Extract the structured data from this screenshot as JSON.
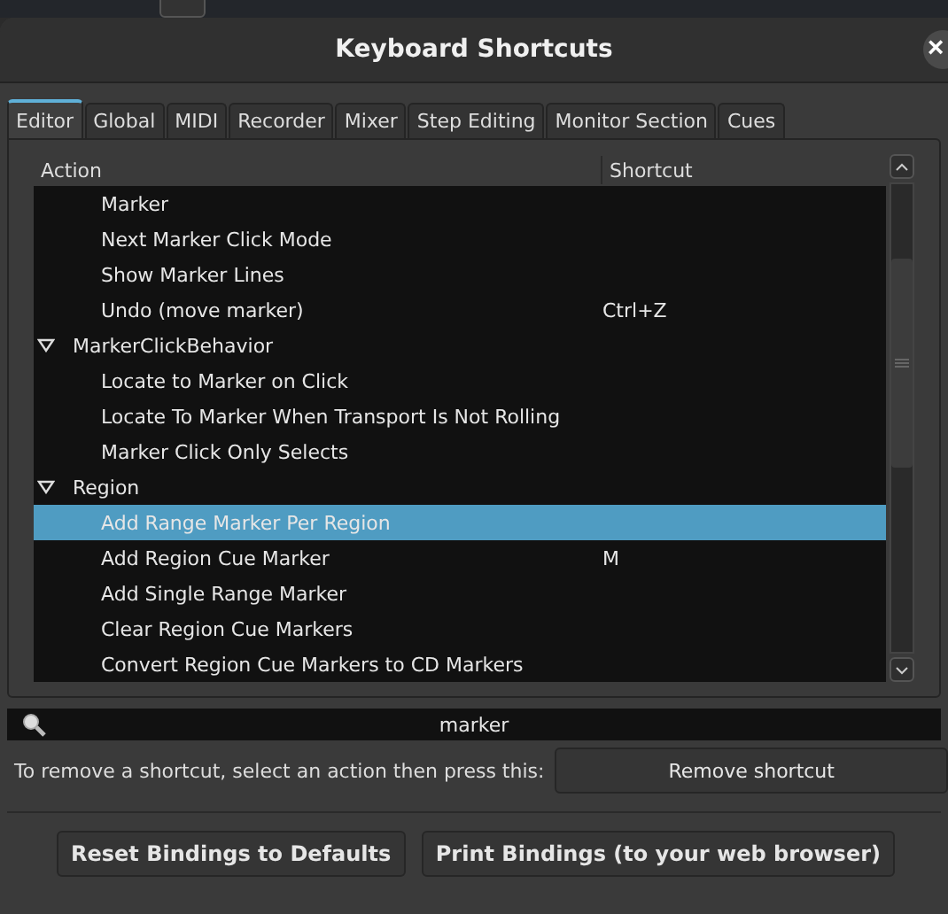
{
  "window": {
    "title": "Keyboard Shortcuts",
    "close": "×"
  },
  "tabs": [
    {
      "label": "Editor",
      "selected": true
    },
    {
      "label": "Global",
      "selected": false
    },
    {
      "label": "MIDI",
      "selected": false
    },
    {
      "label": "Recorder",
      "selected": false
    },
    {
      "label": "Mixer",
      "selected": false
    },
    {
      "label": "Step Editing",
      "selected": false
    },
    {
      "label": "Monitor Section",
      "selected": false
    },
    {
      "label": "Cues",
      "selected": false
    }
  ],
  "table": {
    "columns": [
      "Action",
      "Shortcut"
    ],
    "tree": [
      {
        "children": [
          {
            "action": "Marker",
            "selected": false
          },
          {
            "action": "Next Marker Click Mode",
            "selected": false
          },
          {
            "action": "Show Marker Lines",
            "selected": false
          },
          {
            "action": "Undo (move marker)",
            "shortcut": "Ctrl+Z",
            "selected": false
          }
        ]
      },
      {
        "label": "MarkerClickBehavior",
        "expanded": true,
        "children": [
          {
            "action": "Locate to Marker on Click",
            "selected": false
          },
          {
            "action": "Locate To Marker When Transport Is Not Rolling",
            "selected": false
          },
          {
            "action": "Marker Click Only Selects",
            "selected": false
          }
        ]
      },
      {
        "label": "Region",
        "expanded": true,
        "children": [
          {
            "action": "Add Range Marker Per Region",
            "selected": true
          },
          {
            "action": "Add Region Cue Marker",
            "shortcut": "M",
            "selected": false
          },
          {
            "action": "Add Single Range Marker",
            "selected": false
          },
          {
            "action": "Clear Region Cue Markers",
            "selected": false
          },
          {
            "action": "Convert Region Cue Markers to CD Markers",
            "selected": false
          }
        ]
      }
    ]
  },
  "search": {
    "value": "marker"
  },
  "remove_row": {
    "hint": "To remove a shortcut, select an action then press this:",
    "button": "Remove shortcut"
  },
  "buttons": [
    "Reset Bindings to Defaults",
    "Print Bindings (to your web browser)"
  ]
}
